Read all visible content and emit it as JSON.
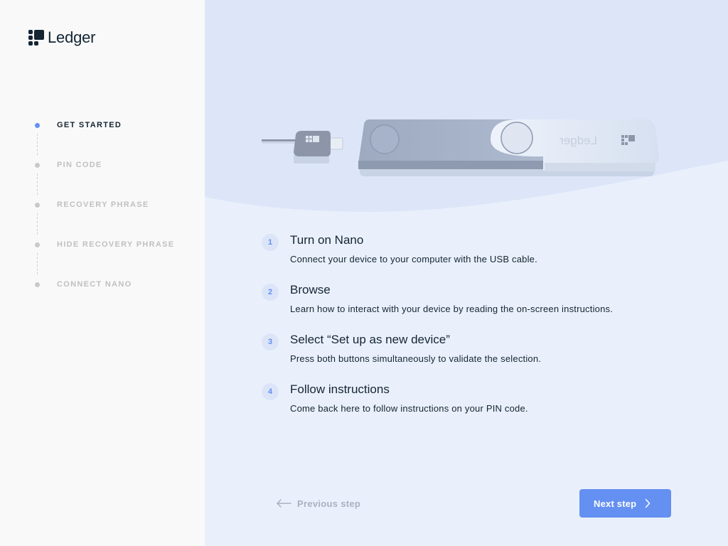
{
  "brand": {
    "name": "Ledger"
  },
  "sidebar": {
    "steps": [
      {
        "label": "GET STARTED",
        "active": true
      },
      {
        "label": "PIN CODE",
        "active": false
      },
      {
        "label": "RECOVERY PHRASE",
        "active": false
      },
      {
        "label": "HIDE RECOVERY PHRASE",
        "active": false
      },
      {
        "label": "CONNECT NANO",
        "active": false
      }
    ]
  },
  "hero": {
    "device_brand": "Ledger",
    "illustration": "nano-s-device-with-usb-cable"
  },
  "instructions": [
    {
      "num": "1",
      "title": "Turn on Nano",
      "desc": "Connect your device to your computer with the USB cable."
    },
    {
      "num": "2",
      "title": "Browse",
      "desc": "Learn how to interact with your device by reading the on-screen instructions."
    },
    {
      "num": "3",
      "title": "Select “Set up as new device”",
      "desc": "Press both buttons simultaneously to validate the selection."
    },
    {
      "num": "4",
      "title": "Follow instructions",
      "desc": "Come back here to follow instructions on your PIN code."
    }
  ],
  "footer": {
    "prev_label": "Previous step",
    "next_label": "Next step",
    "prev_icon": "arrow-left-icon",
    "next_icon": "chevron-right-icon"
  },
  "colors": {
    "accent": "#6490f1",
    "text_dark": "#142533",
    "sidebar_bg": "#f9f9f9",
    "main_bg": "#eaf0fb",
    "hero_bg": "#dde6f9",
    "muted": "#c0c0c0"
  }
}
